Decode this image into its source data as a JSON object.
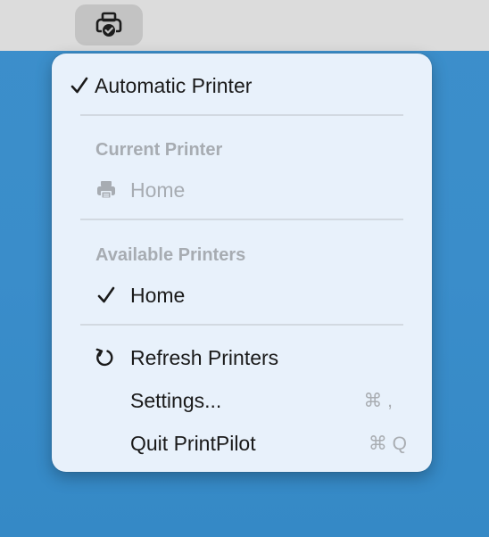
{
  "menubar": {
    "status_icon": "printer-check-icon"
  },
  "menu": {
    "automatic_printer": {
      "label": "Automatic Printer",
      "checked": true
    },
    "current_section": {
      "header": "Current Printer",
      "printer": {
        "label": "Home",
        "icon": "printer-icon",
        "enabled": false
      }
    },
    "available_section": {
      "header": "Available Printers",
      "printers": [
        {
          "label": "Home",
          "checked": true
        }
      ]
    },
    "actions": {
      "refresh": {
        "label": "Refresh Printers",
        "icon": "refresh-icon"
      },
      "settings": {
        "label": "Settings...",
        "shortcut": "⌘ ,"
      },
      "quit": {
        "label": "Quit PrintPilot",
        "shortcut": "⌘ Q"
      }
    }
  }
}
